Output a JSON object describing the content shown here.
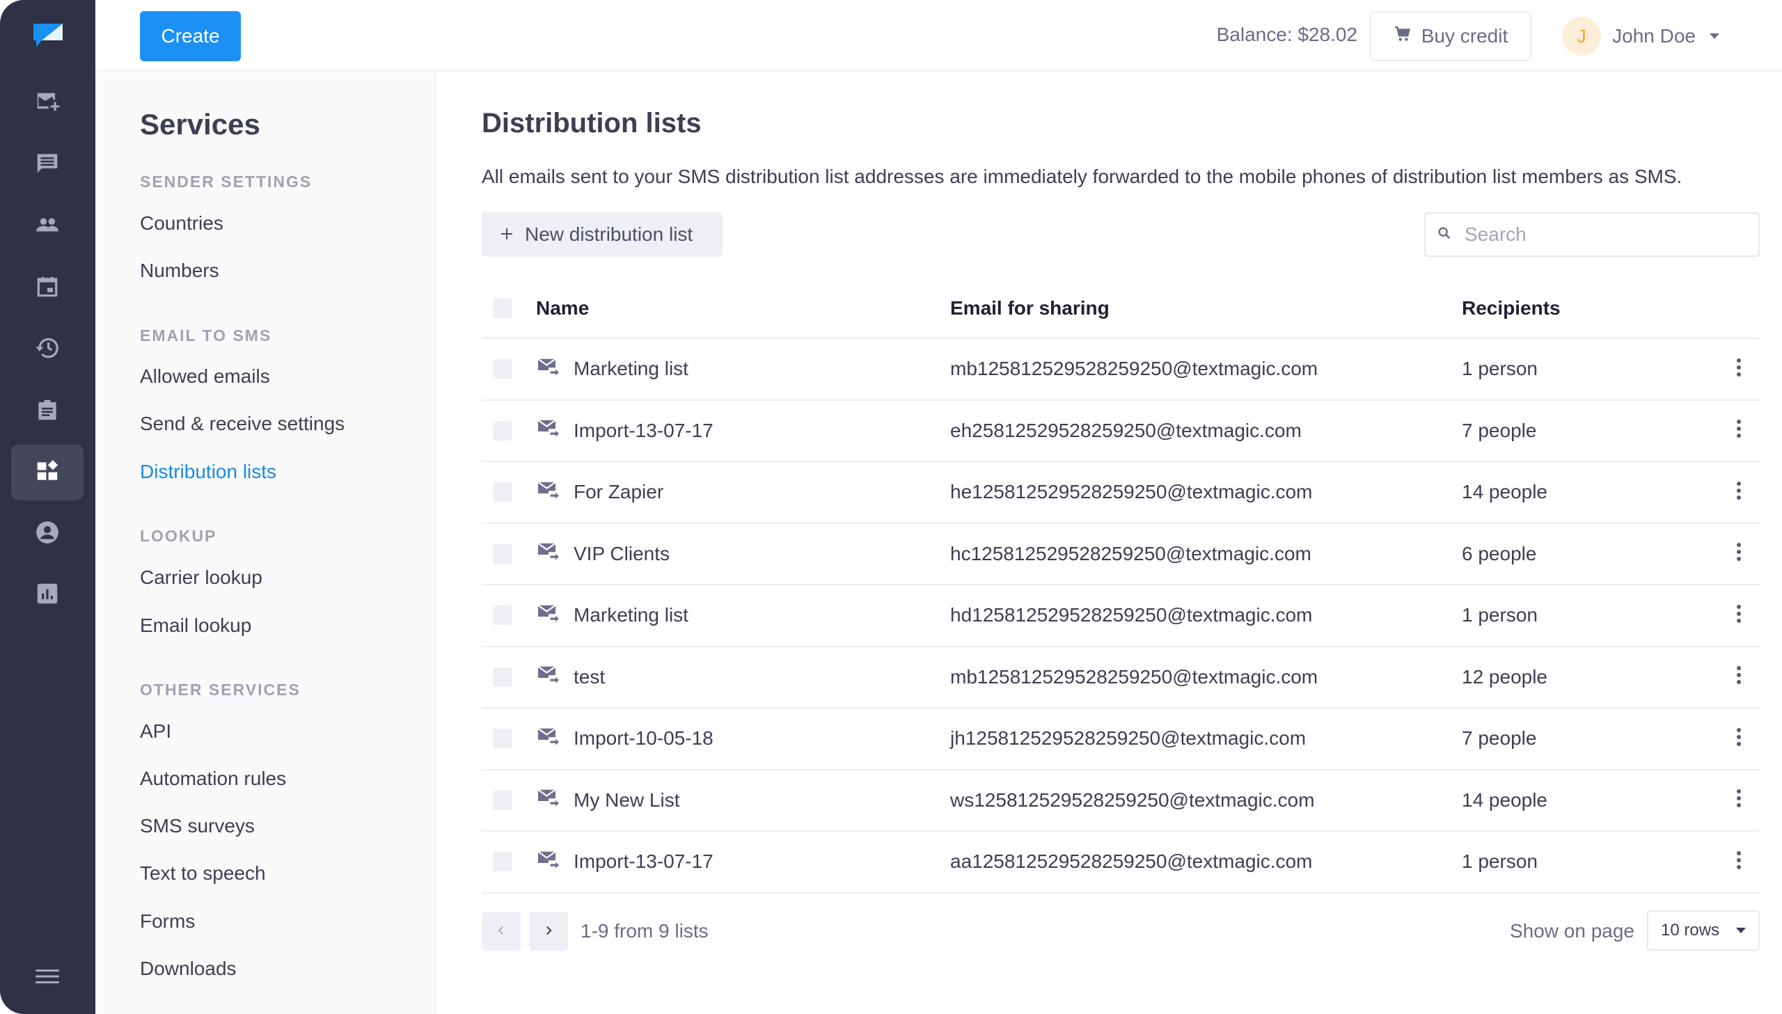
{
  "rail": {
    "logo": "textmagic-logo-icon",
    "items": [
      {
        "name": "compose",
        "icon": "mail-plus-icon",
        "active": false
      },
      {
        "name": "messages",
        "icon": "chat-icon",
        "active": false
      },
      {
        "name": "contacts",
        "icon": "people-icon",
        "active": false
      },
      {
        "name": "scheduled",
        "icon": "calendar-icon",
        "active": false
      },
      {
        "name": "history",
        "icon": "history-icon",
        "active": false
      },
      {
        "name": "templates",
        "icon": "clipboard-icon",
        "active": false
      },
      {
        "name": "services",
        "icon": "apps-icon",
        "active": true
      },
      {
        "name": "account",
        "icon": "account-icon",
        "active": false
      },
      {
        "name": "reports",
        "icon": "bar-chart-icon",
        "active": false
      }
    ],
    "menu_icon": "hamburger-icon"
  },
  "topbar": {
    "create_label": "Create",
    "balance": "Balance: $28.02",
    "buy_credit_label": "Buy credit",
    "user_initial": "J",
    "user_name": "John Doe"
  },
  "subnav": {
    "title": "Services",
    "sections": [
      {
        "label": "SENDER SETTINGS",
        "items": [
          "Countries",
          "Numbers"
        ]
      },
      {
        "label": "EMAIL TO SMS",
        "items": [
          "Allowed emails",
          "Send & receive settings",
          "Distribution lists"
        ]
      },
      {
        "label": "LOOKUP",
        "items": [
          "Carrier lookup",
          "Email lookup"
        ]
      },
      {
        "label": "OTHER SERVICES",
        "items": [
          "API",
          "Automation rules",
          "SMS surveys",
          "Text to speech",
          "Forms",
          "Downloads"
        ]
      }
    ],
    "active_item": "Distribution lists"
  },
  "main": {
    "title": "Distribution lists",
    "description": "All emails sent to your SMS distribution list addresses are immediately forwarded to the mobile phones of distribution list members as SMS.",
    "new_button_label": "New distribution list",
    "search_placeholder": "Search",
    "search_value": "",
    "columns": {
      "name": "Name",
      "email": "Email for sharing",
      "recipients": "Recipients"
    },
    "rows": [
      {
        "name": "Marketing list",
        "email": "mb125812529528259250@textmagic.com",
        "recipients": "1 person"
      },
      {
        "name": "Import-13-07-17",
        "email": "eh25812529528259250@textmagic.com",
        "recipients": "7 people"
      },
      {
        "name": "For Zapier",
        "email": "he125812529528259250@textmagic.com",
        "recipients": "14 people"
      },
      {
        "name": "VIP Clients",
        "email": "hc125812529528259250@textmagic.com",
        "recipients": "6 people"
      },
      {
        "name": "Marketing list",
        "email": "hd125812529528259250@textmagic.com",
        "recipients": "1 person"
      },
      {
        "name": "test",
        "email": "mb125812529528259250@textmagic.com",
        "recipients": "12 people"
      },
      {
        "name": "Import-10-05-18",
        "email": "jh125812529528259250@textmagic.com",
        "recipients": "7 people"
      },
      {
        "name": "My New List",
        "email": "ws125812529528259250@textmagic.com",
        "recipients": "14 people"
      },
      {
        "name": "Import-13-07-17",
        "email": "aa125812529528259250@textmagic.com",
        "recipients": "1 person"
      }
    ],
    "pagination": {
      "info": "1-9 from 9 lists",
      "show_on_page_label": "Show on page",
      "rows_per_page": "10 rows"
    }
  },
  "colors": {
    "accent": "#1a90f5",
    "active_link": "#1a8ae5",
    "rail_bg": "#2f3144",
    "icon_muted": "#6b6c85"
  }
}
